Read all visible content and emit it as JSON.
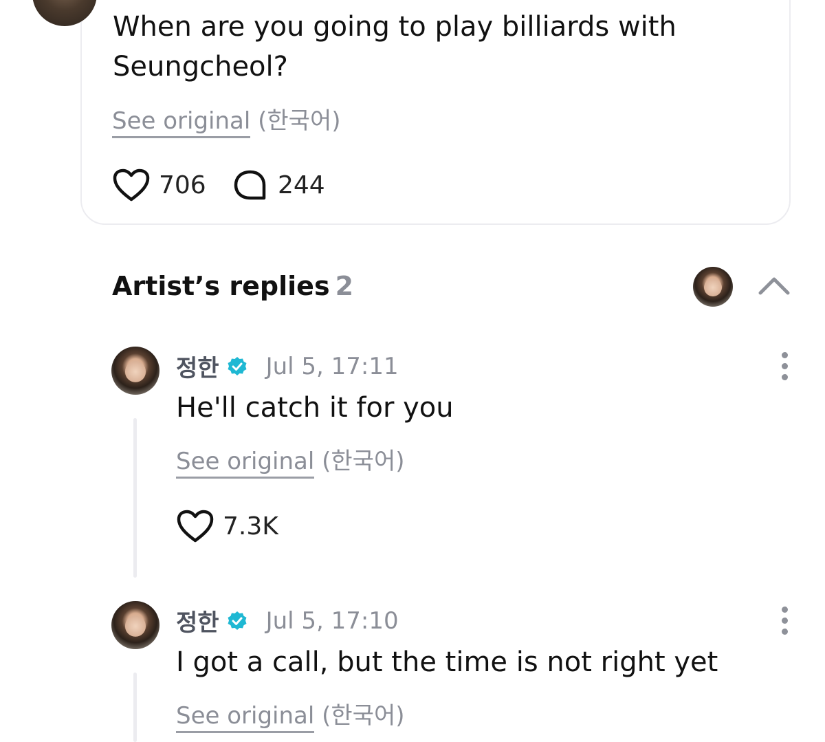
{
  "post": {
    "text": "When are you going to play billiards with Seungcheol?",
    "see_original": "See original",
    "language": "(한국어)",
    "likes": "706",
    "comments": "244"
  },
  "replies_section": {
    "title": "Artist’s replies",
    "count": "2"
  },
  "replies": [
    {
      "author": "정한",
      "time": "Jul 5, 17:11",
      "text": "He'll catch it for you",
      "see_original": "See original",
      "language": "(한국어)",
      "likes": "7.3K"
    },
    {
      "author": "정한",
      "time": "Jul 5, 17:10",
      "text": "I got a call, but the time is not right yet",
      "see_original": "See original",
      "language": "(한국어)"
    }
  ],
  "colors": {
    "verified": "#1fb8d3",
    "muted": "#8b8e97",
    "border": "#ececf0"
  }
}
